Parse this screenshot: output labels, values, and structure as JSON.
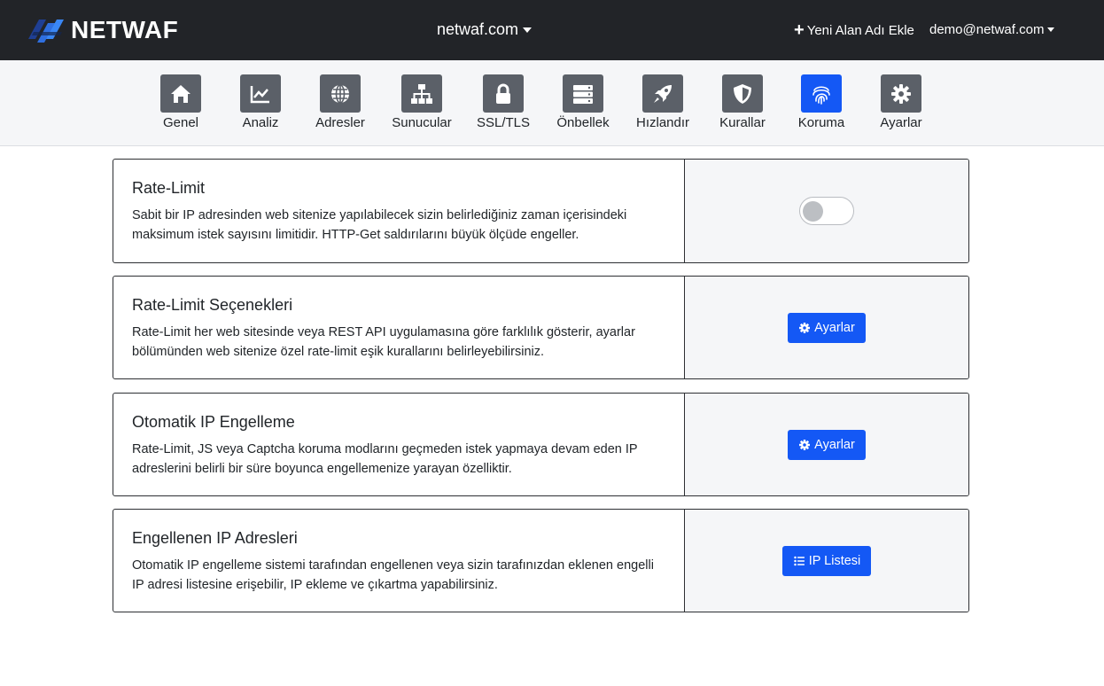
{
  "brand": {
    "name": "NETWAF"
  },
  "header": {
    "domain": "netwaf.com",
    "add_domain_label": "Yeni Alan Adı Ekle",
    "user_email": "demo@netwaf.com"
  },
  "nav": {
    "items": [
      {
        "label": "Genel",
        "icon": "home-icon"
      },
      {
        "label": "Analiz",
        "icon": "chart-icon"
      },
      {
        "label": "Adresler",
        "icon": "globe-icon"
      },
      {
        "label": "Sunucular",
        "icon": "network-icon"
      },
      {
        "label": "SSL/TLS",
        "icon": "lock-icon"
      },
      {
        "label": "Önbellek",
        "icon": "server-icon"
      },
      {
        "label": "Hızlandır",
        "icon": "rocket-icon"
      },
      {
        "label": "Kurallar",
        "icon": "shield-icon"
      },
      {
        "label": "Koruma",
        "icon": "fingerprint-icon"
      },
      {
        "label": "Ayarlar",
        "icon": "gear-icon"
      }
    ],
    "active": "Koruma"
  },
  "cards": [
    {
      "title": "Rate-Limit",
      "desc_line1": "Sabit bir IP adresinden web sitenize yapılabilecek sizin belirlediğiniz zaman içerisindeki",
      "desc_line2": "maksimum istek sayısını limitidir. HTTP-Get saldırılarını büyük ölçüde engeller.",
      "toggle_on": false
    },
    {
      "title": "Rate-Limit Seçenekleri",
      "desc_line1": "Rate-Limit her web sitesinde veya REST API uygulamasına göre farklılık gösterir, ayarlar",
      "desc_line2": "bölümünden web sitenize özel rate-limit eşik kurallarını belirleyebilirsiniz.",
      "button_label": "Ayarlar"
    },
    {
      "title": "Otomatik IP Engelleme",
      "desc_line1": "Rate-Limit, JS veya Captcha koruma modlarını geçmeden istek yapmaya devam eden IP",
      "desc_line2": "adreslerini belirli bir süre boyunca engellemenize yarayan özelliktir.",
      "button_label": "Ayarlar"
    },
    {
      "title": "Engellenen IP Adresleri",
      "desc_line1": "Otomatik IP engelleme sistemi tarafından engellenen veya sizin tarafınızdan eklenen engelli",
      "desc_line2": "IP adresi listesine erişebilir, IP ekleme ve çıkartma yapabilirsiniz.",
      "button_label": "IP Listesi"
    }
  ],
  "colors": {
    "topbar": "#222428",
    "accent": "#1458f5",
    "tile": "#5b6068",
    "panel": "#f5f6f8"
  }
}
